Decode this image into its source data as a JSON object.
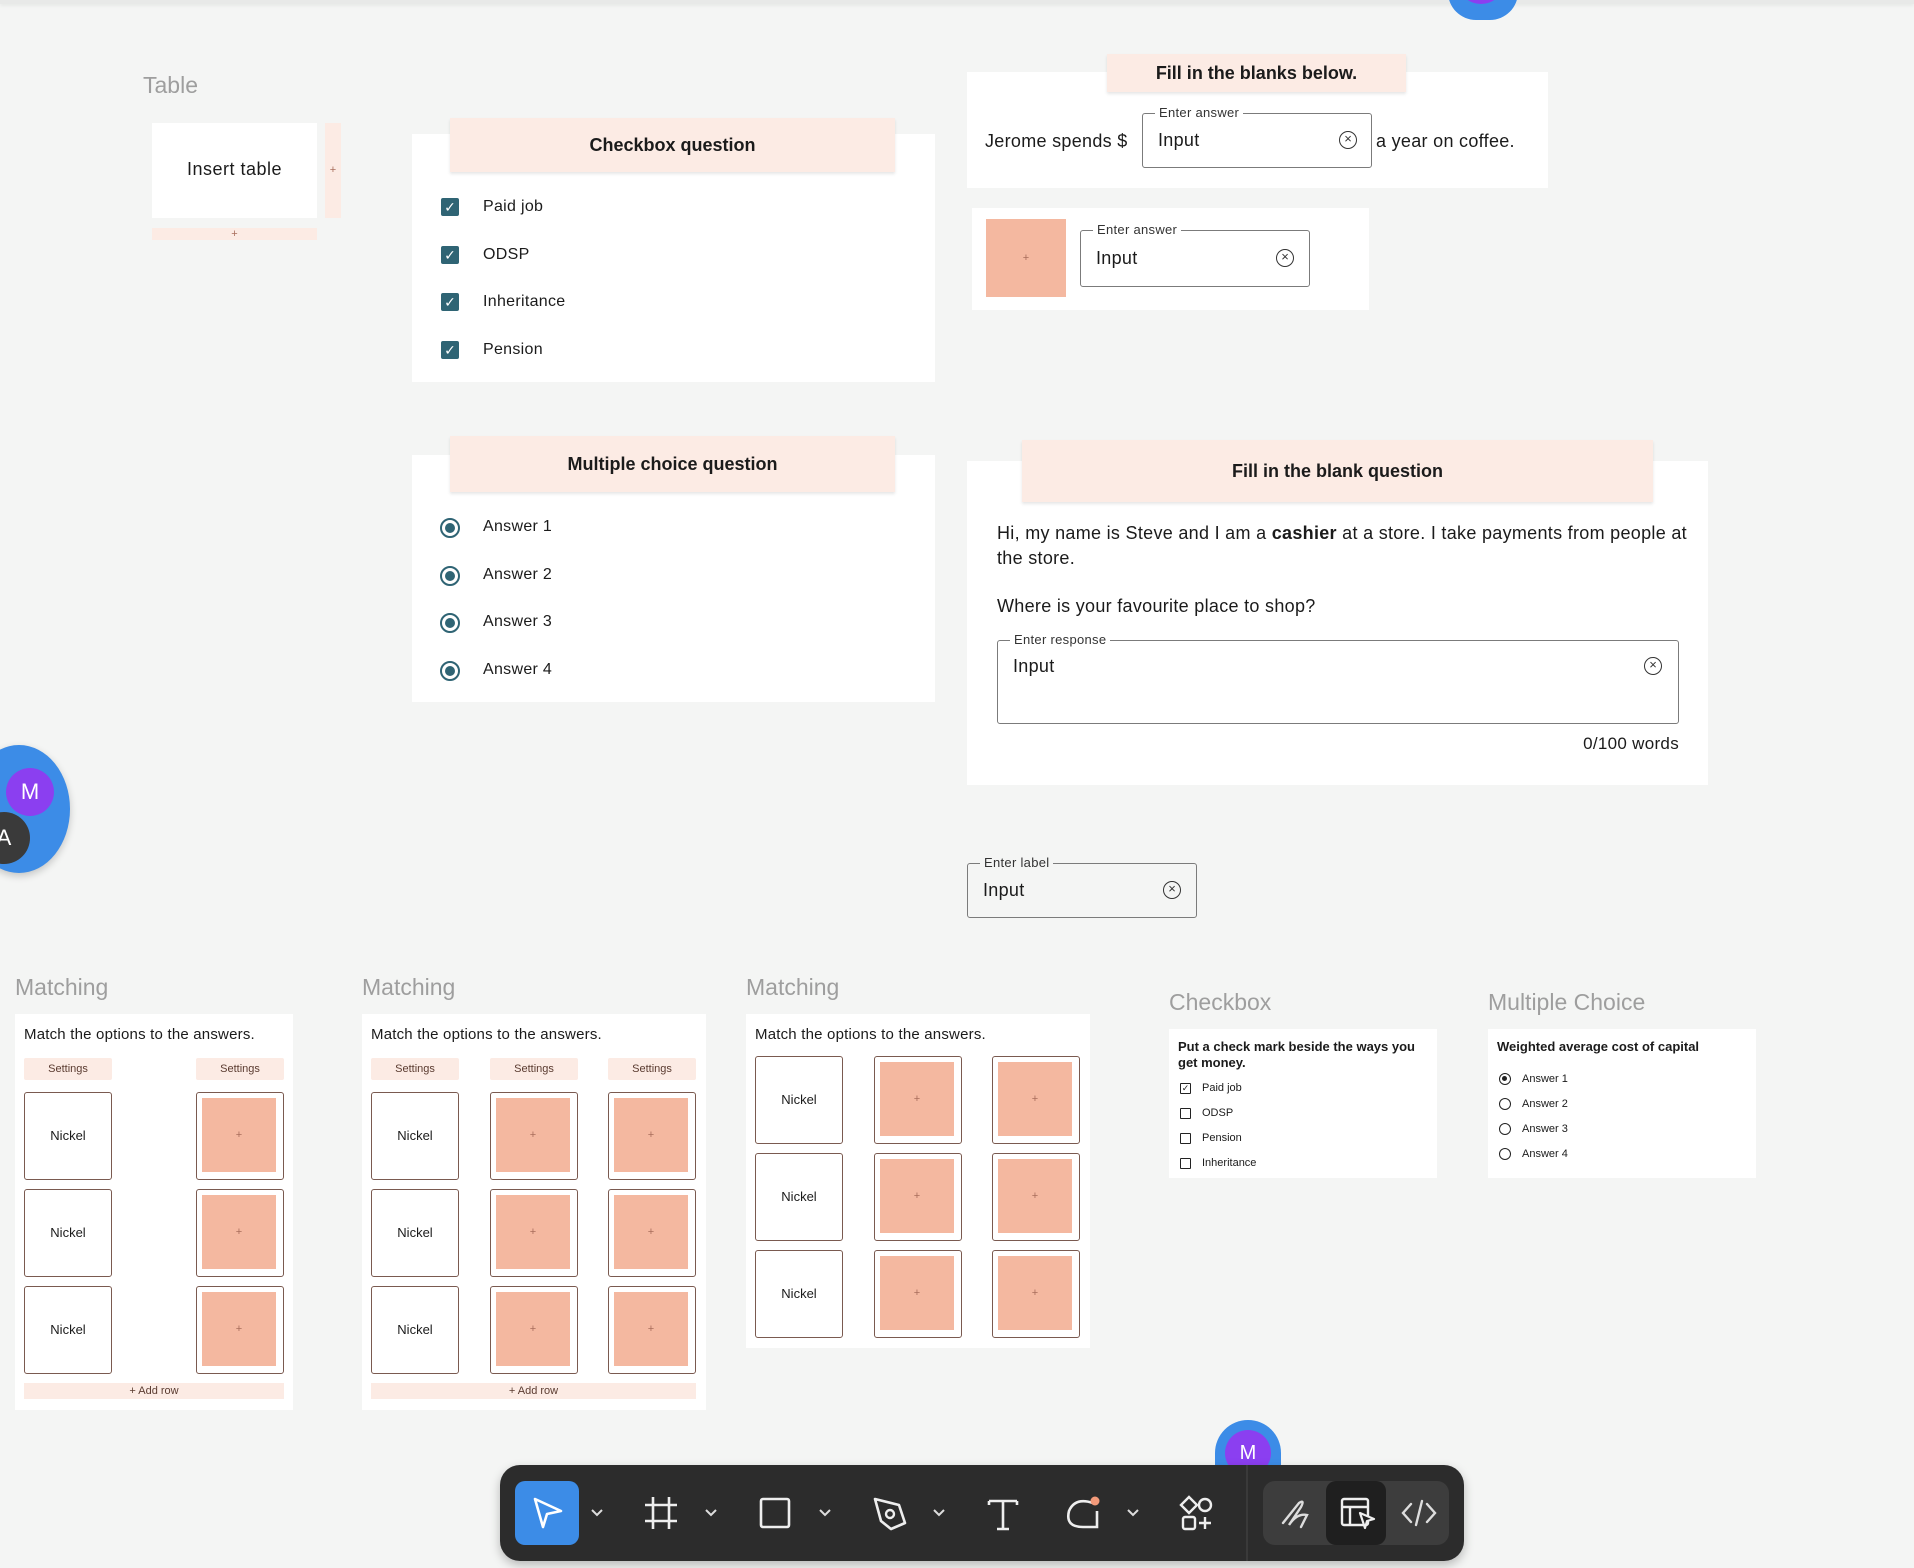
{
  "table": {
    "section_label": "Table",
    "insert_label": "Insert table",
    "plus": "+"
  },
  "checkbox_q": {
    "title": "Checkbox question",
    "options": [
      "Paid job",
      "ODSP",
      "Inheritance",
      "Pension"
    ]
  },
  "mc_q": {
    "title": "Multiple choice question",
    "options": [
      "Answer 1",
      "Answer 2",
      "Answer 3",
      "Answer 4"
    ]
  },
  "fill_blanks": {
    "title": "Fill in the blanks below.",
    "prefix": "Jerome spends $",
    "legend": "Enter answer",
    "value": "Input",
    "suffix": "a year on coffee."
  },
  "fill_image": {
    "legend": "Enter answer",
    "value": "Input",
    "plus": "+"
  },
  "fill_blank_q": {
    "title": "Fill in the blank question",
    "text_before": "Hi, my name is Steve and I am a ",
    "text_bold": "cashier",
    "text_after": " at a store. I take payments from people at the store.",
    "question": "Where is your favourite place to shop?",
    "legend": "Enter response",
    "value": "Input",
    "word_count": "0/100 words"
  },
  "label_field": {
    "legend": "Enter label",
    "value": "Input"
  },
  "matching": {
    "section_label": "Matching",
    "prompt": "Match the options to the answers.",
    "settings": "Settings",
    "option": "Nickel",
    "plus": "+",
    "add_row": "+ Add row"
  },
  "mini_checkbox": {
    "section_label": "Checkbox",
    "title": "Put a check mark beside the ways you get money.",
    "options": [
      "Paid job",
      "ODSP",
      "Pension",
      "Inheritance"
    ],
    "checked": [
      "Paid job"
    ]
  },
  "mini_mc": {
    "section_label": "Multiple Choice",
    "title": "Weighted average cost of capital",
    "options": [
      "Answer 1",
      "Answer 2",
      "Answer 3",
      "Answer 4"
    ],
    "selected": "Answer 1"
  },
  "avatars": {
    "m": "M",
    "a": "A"
  },
  "toolbar": {
    "tools": [
      "move-tool",
      "frame-tool",
      "rectangle-tool",
      "pen-tool",
      "text-tool",
      "ellipse-tool",
      "components-tool",
      "draw-mode",
      "design-mode",
      "dev-mode"
    ]
  },
  "colors": {
    "accent_teal": "#2f6474",
    "peach": "#f4b8a0",
    "peach_light": "#fcebe4",
    "toolbar_blue": "#3c8ce7",
    "avatar_purple": "#8b3ff0"
  }
}
